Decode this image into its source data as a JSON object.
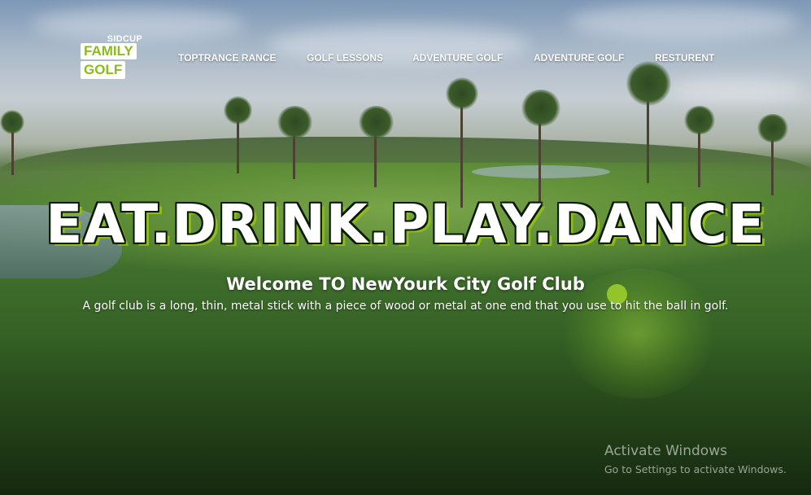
{
  "logo": {
    "top_text": "SIDCUP",
    "line1": "FAMILY",
    "line2": "GOLF",
    "accent_color": "#8dbb1e"
  },
  "nav": {
    "items": [
      {
        "label": "TOPTRANCE RANCE"
      },
      {
        "label": "GOLF LESSONS"
      },
      {
        "label": "ADVENTURE GOLF"
      },
      {
        "label": "ADVENTURE GOLF"
      },
      {
        "label": "RESTURENT"
      }
    ]
  },
  "hero": {
    "headline": "EAT.DRINK.PLAY.DANCE",
    "welcome": "Welcome TO NewYourk City Golf Club",
    "description": "A golf club is a long, thin, metal stick with a piece of wood or metal at one end that you use to hit the ball in golf."
  },
  "watermark": {
    "title": "Activate Windows",
    "subtitle": "Go to Settings to activate Windows."
  }
}
